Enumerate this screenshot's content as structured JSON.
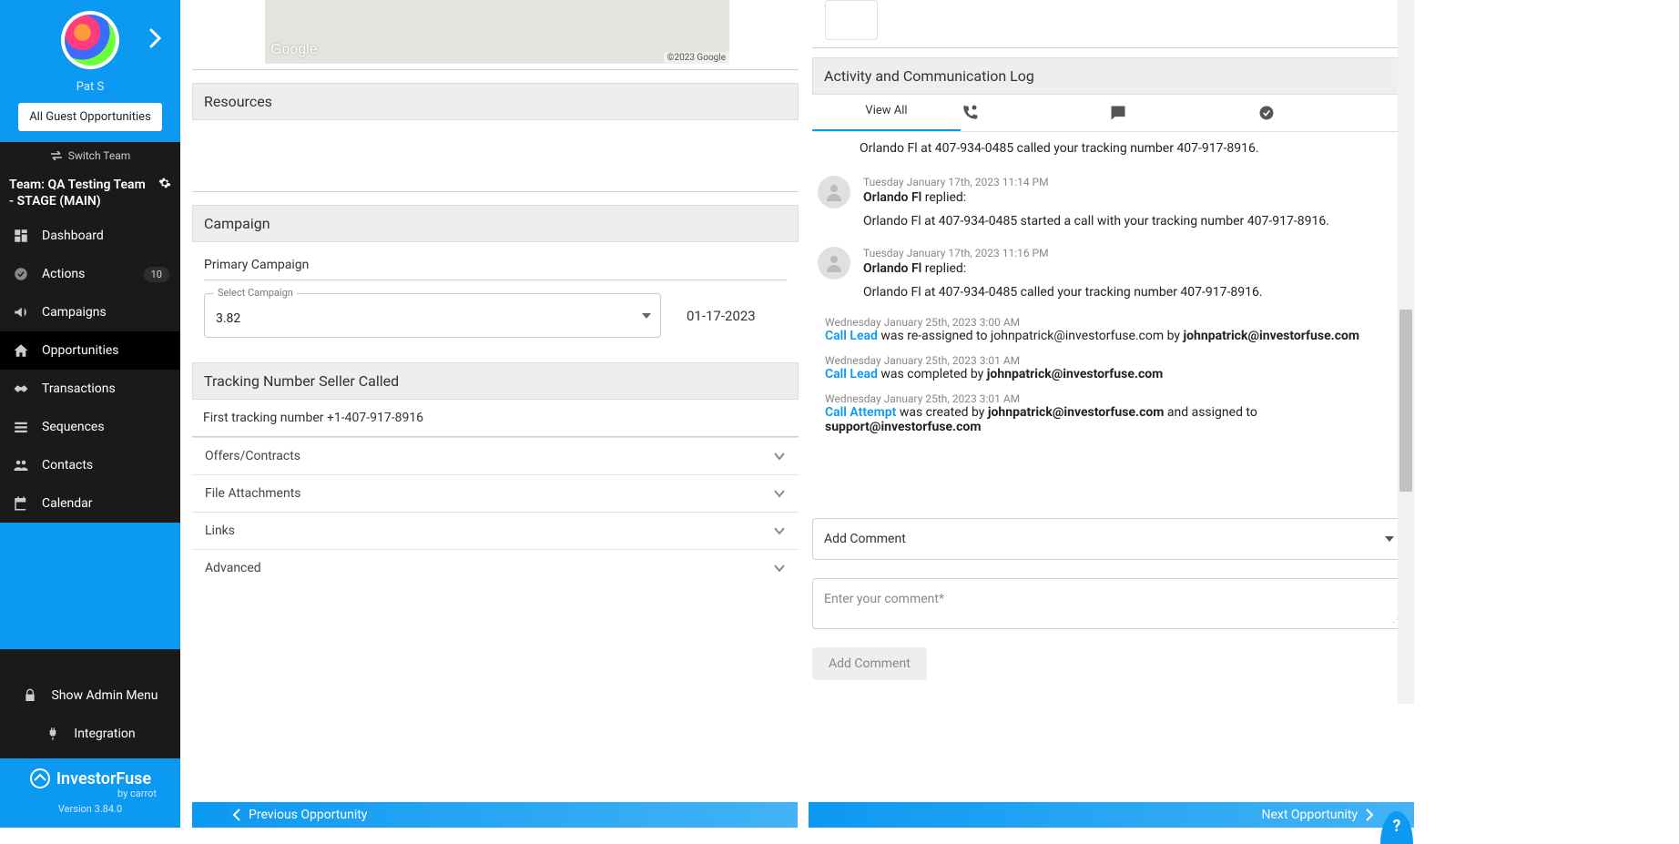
{
  "user": {
    "name": "Pat S"
  },
  "sidebar": {
    "guest_button": "All Guest Opportunities",
    "switch_team": "Switch Team",
    "team_label": "Team: QA Testing Team - STAGE (MAIN)",
    "items": [
      {
        "icon": "dashboard-icon",
        "label": "Dashboard",
        "badge": null
      },
      {
        "icon": "check-circle-icon",
        "label": "Actions",
        "badge": "10"
      },
      {
        "icon": "campaign-icon",
        "label": "Campaigns",
        "badge": null
      },
      {
        "icon": "home-icon",
        "label": "Opportunities",
        "badge": null
      },
      {
        "icon": "handshake-icon",
        "label": "Transactions",
        "badge": null
      },
      {
        "icon": "sequence-icon",
        "label": "Sequences",
        "badge": null
      },
      {
        "icon": "people-icon",
        "label": "Contacts",
        "badge": null
      },
      {
        "icon": "calendar-icon",
        "label": "Calendar",
        "badge": null
      }
    ],
    "admin": {
      "show": "Show Admin Menu",
      "integration": "Integration"
    }
  },
  "logo": {
    "brand": "InvestorFuse",
    "byline": "by carrot",
    "version": "Version 3.84.0"
  },
  "map": {
    "provider": "Google",
    "copyright": "©2023 Google"
  },
  "left": {
    "resources_title": "Resources",
    "campaign_title": "Campaign",
    "primary_campaign_label": "Primary Campaign",
    "select_float": "Select Campaign",
    "select_value": "3.82",
    "campaign_date": "01-17-2023",
    "tracking_title": "Tracking Number Seller Called",
    "tracking_text": "First tracking number +1-407-917-8916",
    "accordions": [
      "Offers/Contracts",
      "File Attachments",
      "Links",
      "Advanced"
    ]
  },
  "nav_buttons": {
    "prev": "Previous Opportunity",
    "next": "Next Opportunity"
  },
  "right": {
    "activity_title": "Activity and Communication Log",
    "view_all": "View All",
    "truncated_top": "Orlando Fl at 407-934-0485 called your tracking number 407-917-8916.",
    "entries": [
      {
        "ts": "Tuesday January 17th, 2023 11:14 PM",
        "who": "Orlando Fl",
        "suffix": " replied:",
        "msg": "Orlando Fl at 407-934-0485 started a call with your tracking number 407-917-8916."
      },
      {
        "ts": "Tuesday January 17th, 2023 11:16 PM",
        "who": "Orlando Fl",
        "suffix": " replied:",
        "msg": "Orlando Fl at 407-934-0485 called your tracking number 407-917-8916."
      }
    ],
    "system": [
      {
        "ts": "Wednesday January 25th, 2023 3:00 AM",
        "tag": "Call Lead",
        "mid": " was re-assigned to johnpatrick@investorfuse.com by ",
        "bold": "johnpatrick@investorfuse.com"
      },
      {
        "ts": "Wednesday January 25th, 2023 3:01 AM",
        "tag": "Call Lead",
        "mid": " was completed by ",
        "bold": "johnpatrick@investorfuse.com"
      },
      {
        "ts": "Wednesday January 25th, 2023 3:01 AM",
        "tag": "Call Attempt",
        "mid": " was created by ",
        "bold": "johnpatrick@investorfuse.com",
        "tail": " and assigned to ",
        "bold2": "support@investorfuse.com"
      }
    ],
    "comment_type": "Add Comment",
    "comment_placeholder": "Enter your comment*",
    "add_comment_btn": "Add Comment"
  }
}
